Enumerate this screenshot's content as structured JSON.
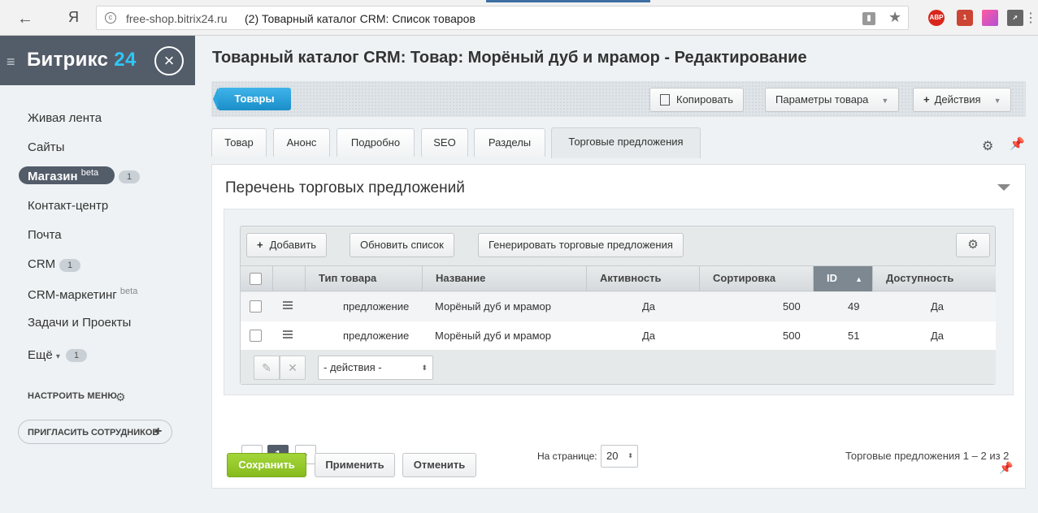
{
  "browser": {
    "domain": "free-shop.bitrix24.ru",
    "tab_title": "(2) Товарный каталог CRM: Список товаров",
    "yandex_glyph": "Я",
    "ext_abp": "ABP"
  },
  "sidebar": {
    "logo_main": "Битрикс",
    "logo_num": "24",
    "items": [
      {
        "label": "Живая лента"
      },
      {
        "label": "Сайты"
      },
      {
        "label": "Магазин",
        "sup": "beta",
        "counter": "1",
        "active": true
      },
      {
        "label": "Контакт-центр"
      },
      {
        "label": "Почта"
      },
      {
        "label": "CRM",
        "counter": "1"
      },
      {
        "label": "CRM-маркетинг",
        "sup": "beta"
      },
      {
        "label": "Задачи и Проекты"
      },
      {
        "label": "Ещё",
        "counter": "1"
      }
    ],
    "configure_menu": "НАСТРОИТЬ МЕНЮ",
    "invite": "ПРИГЛАСИТЬ СОТРУДНИКОВ"
  },
  "page": {
    "title": "Товарный каталог CRM: Товар: Морёный дуб и мрамор - Редактирование"
  },
  "toolbar": {
    "back_label": "Товары",
    "copy_label": "Копировать",
    "params_label": "Параметры товара",
    "actions_label": "Действия"
  },
  "tabs": [
    {
      "label": "Товар"
    },
    {
      "label": "Анонс"
    },
    {
      "label": "Подробно"
    },
    {
      "label": "SEO"
    },
    {
      "label": "Разделы"
    },
    {
      "label": "Торговые предложения",
      "active": true
    }
  ],
  "panel": {
    "title": "Перечень торговых предложений"
  },
  "grid": {
    "add_label": "Добавить",
    "refresh_label": "Обновить список",
    "generate_label": "Генерировать торговые предложения",
    "columns": [
      {
        "label": "Тип товара"
      },
      {
        "label": "Название"
      },
      {
        "label": "Активность"
      },
      {
        "label": "Сортировка"
      },
      {
        "label": "ID",
        "sorted": "asc"
      },
      {
        "label": "Доступность"
      }
    ],
    "rows": [
      {
        "type": "предложение",
        "name": "Морёный дуб и мрамор",
        "active": "Да",
        "sort": "500",
        "id": "49",
        "available": "Да"
      },
      {
        "type": "предложение",
        "name": "Морёный дуб и мрамор",
        "active": "Да",
        "sort": "500",
        "id": "51",
        "available": "Да"
      }
    ],
    "actions_select": "- действия -"
  },
  "pagination": {
    "prev": "‹",
    "current": "1",
    "next": "›",
    "per_page_label": "На странице:",
    "per_page_value": "20",
    "count_label": "Торговые предложения 1 – 2 из 2"
  },
  "form_buttons": {
    "save": "Сохранить",
    "apply": "Применить",
    "cancel": "Отменить"
  }
}
